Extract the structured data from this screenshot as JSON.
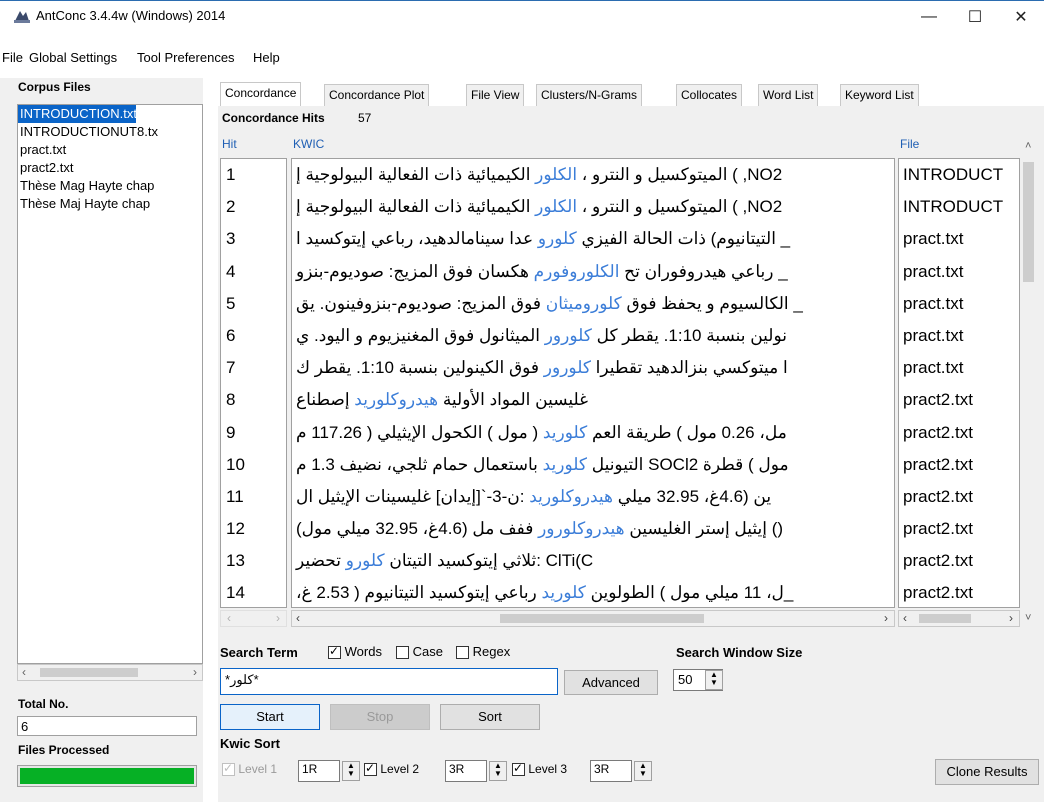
{
  "window": {
    "title": "AntConc 3.4.4w (Windows) 2014",
    "min": "—",
    "max": "☐",
    "close": "✕"
  },
  "menu": [
    "File",
    "Global Settings",
    "Tool Preferences",
    "Help"
  ],
  "left": {
    "corpus_label": "Corpus Files",
    "files": [
      "INTRODUCTION.txt",
      "INTRODUCTIONUT8.tx",
      "pract.txt",
      "pract2.txt",
      "Thèse Mag Hayte chap",
      "Thèse Maj Hayte chap"
    ],
    "total_label": "Total No.",
    "total_value": "6",
    "processed_label": "Files Processed",
    "progress": 1.0
  },
  "tabs": [
    "Concordance",
    "Concordance Plot",
    "File View",
    "Clusters/N-Grams",
    "Collocates",
    "Word List",
    "Keyword List"
  ],
  "hits": {
    "label": "Concordance Hits",
    "count": "57"
  },
  "columns": {
    "hit": "Hit",
    "kwic": "KWIC",
    "file": "File"
  },
  "rows": [
    {
      "hit": "1",
      "left": "NO2, ) الميتوكسيل و النترو ، ",
      "kw": "الكلور",
      "right": " الكيميائية ذات الفعالية البيولوجية إ",
      "file": "INTRODUCT"
    },
    {
      "hit": "2",
      "left": "NO2, ) الميتوكسيل و النترو ، ",
      "kw": "الكلور",
      "right": " الكيميائية ذات الفعالية البيولوجية إ",
      "file": "INTRODUCT"
    },
    {
      "hit": "3",
      "left": "_ التيتانيوم) ذات الحالة الفيزي ",
      "kw": "كلورو",
      "right": " عدا سينامالدهيد، رباعي إيتوكسيد ا",
      "file": "pract.txt"
    },
    {
      "hit": "4",
      "left": "_ رباعي هيدروفوران تح ",
      "kw": "الكلوروفورم",
      "right": " هكسان فوق المزيج: صوديوم-بنزو",
      "file": "pract.txt"
    },
    {
      "hit": "5",
      "left": "_ الكالسيوم و يحفظ فوق ",
      "kw": "كلوروميثان",
      "right": " فوق المزيج: صوديوم-بنزوفينون. يق",
      "file": "pract.txt"
    },
    {
      "hit": "6",
      "left": "نولين بنسبة 1:10. يقطر كل ",
      "kw": "كلورور",
      "right": " الميثانول فوق المغنيزيوم و اليود. ي",
      "file": "pract.txt"
    },
    {
      "hit": "7",
      "left": "ا ميتوكسي بنزالدهيد تقطيرا ",
      "kw": "كلورور",
      "right": " فوق الكينولين بنسبة 1:10. يقطر ك",
      "file": "pract.txt"
    },
    {
      "hit": "8",
      "left": "غليسين   المواد الأولية ",
      "kw": "هيدروكلوريد",
      "right": " إصطناع",
      "file": "pract2.txt"
    },
    {
      "hit": "9",
      "left": "مل، 0.26 مول )  طريقة العم ",
      "kw": "كلوريد",
      "right": " ( مول ) الكحول الإيثيلي ( 117.26 م",
      "file": "pract2.txt"
    },
    {
      "hit": "10",
      "left": "مول ) قطرة SOCl2 التيونيل ",
      "kw": "كلوريد",
      "right": " باستعمال حمام ثلجي، نضيف 1.3 م",
      "file": "pract2.txt"
    },
    {
      "hit": "11",
      "left": "ين (4.6غ، 32.95 ميلي ",
      "kw": "هيدروكلوريد",
      "right": " :ن-3-`[إيدان] غليسينات الإيثيل   ال",
      "file": "pract2.txt"
    },
    {
      "hit": "12",
      "left": "() إيثيل إستر الغليسين ",
      "kw": "هيدروكلورور",
      "right": " ففف مل (4.6غ، 32.95 ميلي مول)",
      "file": "pract2.txt"
    },
    {
      "hit": "13",
      "left": "ClTi(C :ثلاثي إيتوكسيد التيتان ",
      "kw": "كلورو",
      "right": " تحضير",
      "file": "pract2.txt"
    },
    {
      "hit": "14",
      "left": "_ل، 11 ميلي مول ) الطولوين ",
      "kw": "كلوريد",
      "right": " رباعي إيتوكسيد التيتانيوم ( 2.53 غ،",
      "file": "pract2.txt"
    }
  ],
  "search": {
    "label": "Search Term",
    "words_label": "Words",
    "words": true,
    "case_label": "Case",
    "case": false,
    "regex_label": "Regex",
    "regex": false,
    "value": "*كلور*",
    "advanced": "Advanced",
    "window_label": "Search Window Size",
    "window_value": "50",
    "start": "Start",
    "stop": "Stop",
    "sort": "Sort"
  },
  "kwic_sort": {
    "label": "Kwic Sort",
    "level1_label": "Level 1",
    "level1": "1R",
    "level2_label": "Level 2",
    "level2": "3R",
    "level3_label": "Level 3",
    "level3": "3R"
  },
  "clone": "Clone Results"
}
